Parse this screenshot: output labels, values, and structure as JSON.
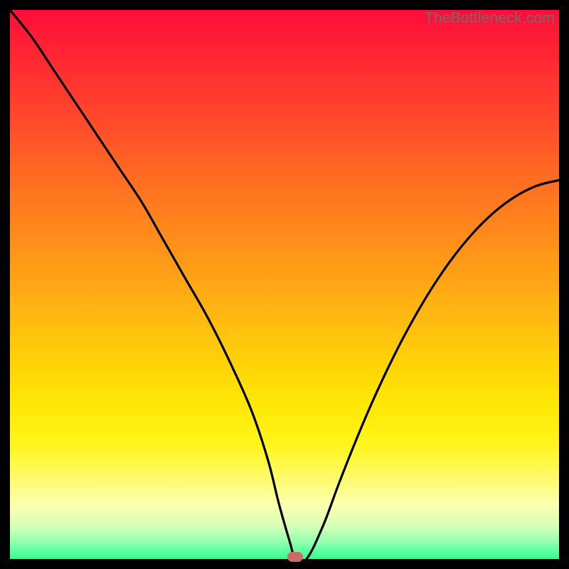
{
  "watermark": "TheBottleneck.com",
  "colors": {
    "frame": "#000000",
    "curve": "#000000",
    "marker": "#cc6b66",
    "gradient_stops": [
      "#ff0d3a",
      "#ffd208",
      "#2fff8f"
    ]
  },
  "chart_data": {
    "type": "line",
    "title": "",
    "xlabel": "",
    "ylabel": "",
    "xlim": [
      0,
      100
    ],
    "ylim": [
      0,
      100
    ],
    "description": "V-shaped bottleneck curve over red→yellow→green vertical gradient; minimum near x≈52, y≈0",
    "marker": {
      "x": 52,
      "y": 0
    },
    "series": [
      {
        "name": "bottleneck-curve",
        "x": [
          0,
          4,
          8,
          12,
          16,
          20,
          24,
          28,
          32,
          36,
          40,
          44,
          47,
          49,
          51,
          52,
          54,
          57,
          60,
          64,
          68,
          72,
          76,
          80,
          84,
          88,
          92,
          96,
          100
        ],
        "values": [
          100,
          95,
          89,
          83,
          77,
          71,
          65,
          58,
          51,
          44,
          36,
          27,
          18,
          10,
          3,
          0,
          0,
          6,
          14,
          24,
          33,
          41,
          48,
          54,
          59,
          63,
          66,
          68,
          69
        ]
      }
    ]
  }
}
